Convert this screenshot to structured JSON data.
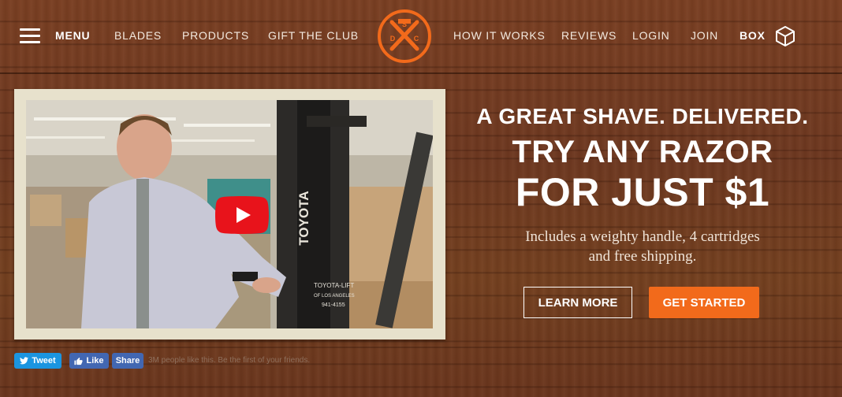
{
  "nav": {
    "menu_label": "MENU",
    "left_items": [
      "BLADES",
      "PRODUCTS",
      "GIFT THE CLUB"
    ],
    "right_items": [
      "HOW IT WORKS",
      "REVIEWS",
      "LOGIN",
      "JOIN"
    ],
    "box_label": "BOX",
    "logo_letters": [
      "S",
      "D",
      "C"
    ],
    "brand_color": "#f26a1b"
  },
  "video": {
    "poster_text": [
      "TOYOTA",
      "TOYOTA-LIFT",
      "OF LOS ANGELES",
      "941-4155"
    ]
  },
  "hero": {
    "tagline": "A GREAT SHAVE. DELIVERED.",
    "headline_line1": "TRY ANY RAZOR",
    "headline_line2": "FOR JUST $1",
    "subtext_line1": "Includes a weighty handle, 4 cartridges",
    "subtext_line2": "and free shipping.",
    "learn_more": "LEARN MORE",
    "get_started": "GET STARTED"
  },
  "social": {
    "tweet": "Tweet",
    "like": "Like",
    "share": "Share",
    "like_text": "3M people like this. Be the first of your friends."
  }
}
